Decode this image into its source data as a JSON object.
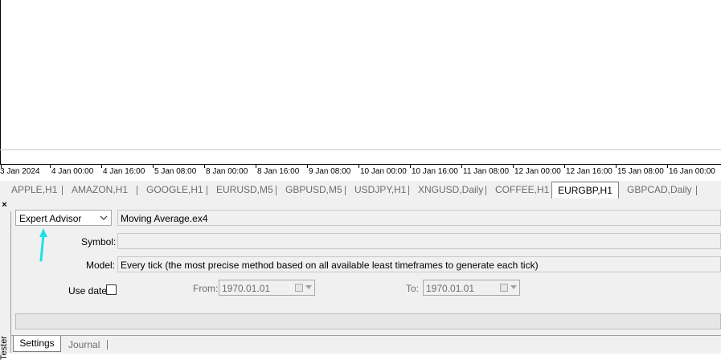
{
  "time_axis": {
    "labels": [
      "3 Jan 2024",
      "4 Jan 00:00",
      "4 Jan 16:00",
      "5 Jan 08:00",
      "8 Jan 00:00",
      "8 Jan 16:00",
      "9 Jan 08:00",
      "10 Jan 00:00",
      "10 Jan 16:00",
      "11 Jan 08:00",
      "12 Jan 00:00",
      "12 Jan 16:00",
      "15 Jan 08:00",
      "16 Jan 00:00"
    ]
  },
  "symbol_tabs": {
    "items": [
      "APPLE,H1",
      "AMAZON,H1",
      "GOOGLE,H1",
      "EURUSD,M5",
      "GBPUSD,M5",
      "USDJPY,H1",
      "XNGUSD,Daily",
      "COFFEE,H1",
      "EURGBP,H1",
      "GBPCAD,Daily"
    ],
    "active": "EURGBP,H1"
  },
  "tester": {
    "side_label": "Tester",
    "close_glyph": "×",
    "program_type": "Expert Advisor",
    "expert_file": "Moving Average.ex4",
    "symbol_label": "Symbol:",
    "symbol_value": "",
    "model_label": "Model:",
    "model_value": "Every tick (the most precise method based on all available least timeframes to generate each tick)",
    "use_date_label": "Use date",
    "use_date_checked": false,
    "from_label": "From:",
    "from_value": "1970.01.01",
    "to_label": "To:",
    "to_value": "1970.01.01"
  },
  "bottom_tabs": {
    "settings": "Settings",
    "journal": "Journal",
    "active": "Settings"
  },
  "colors": {
    "annotation_arrow": "#1ee0ea",
    "panel_bg": "#f0f0f0"
  }
}
